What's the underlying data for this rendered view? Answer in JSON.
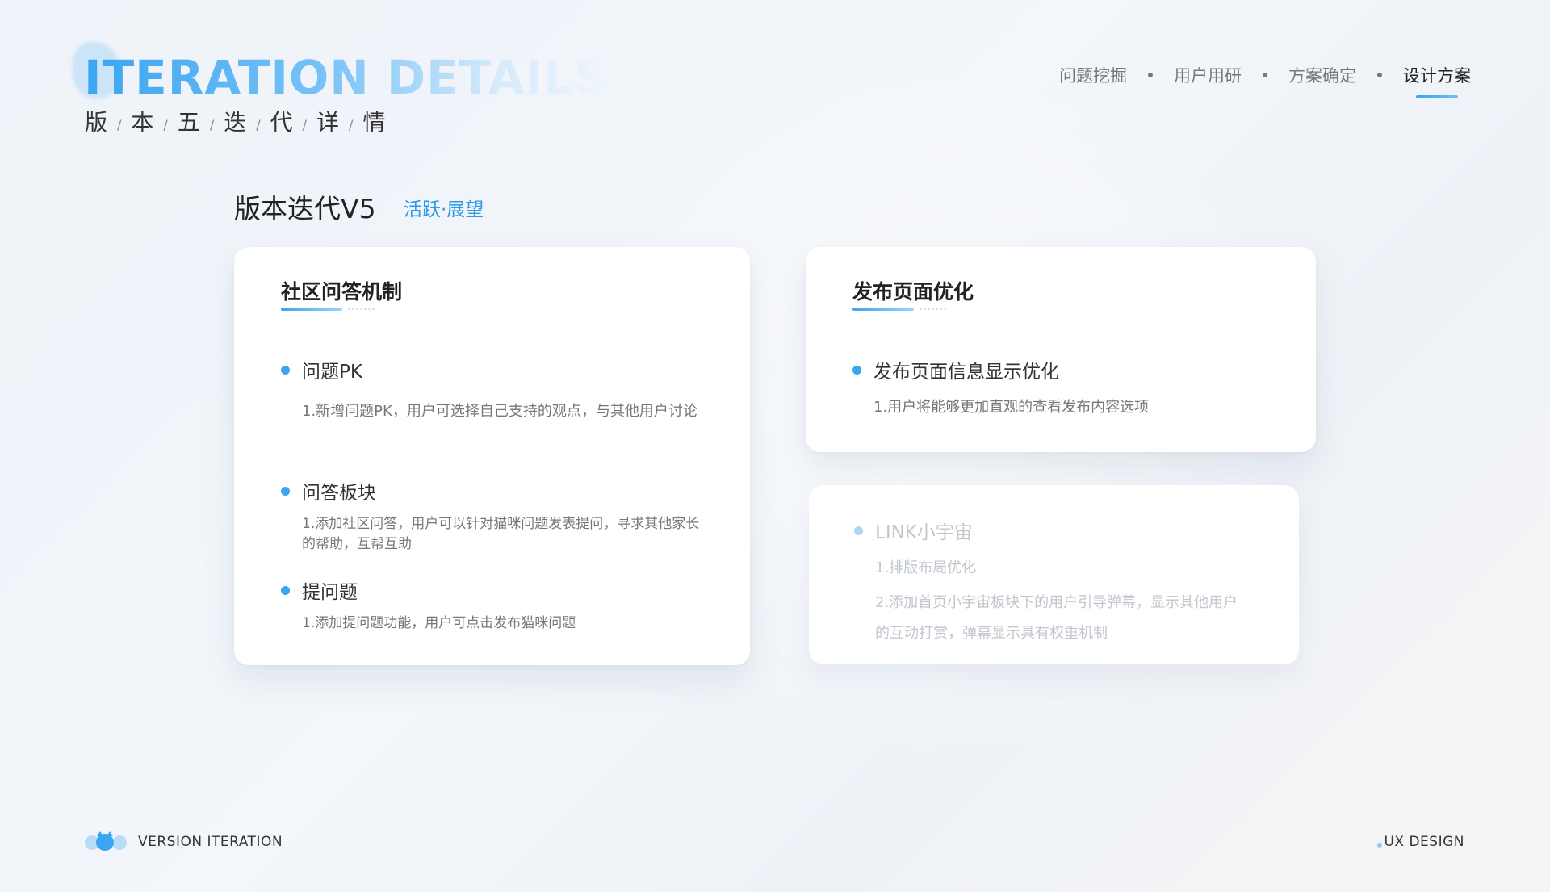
{
  "header": {
    "hero_title": "ITERATION DETAILS",
    "subtitle_chars": [
      "版",
      "本",
      "五",
      "迭",
      "代",
      "详",
      "情"
    ],
    "subtitle_separator": "/"
  },
  "nav": {
    "items": [
      {
        "label": "问题挖掘",
        "active": false
      },
      {
        "label": "用户用研",
        "active": false
      },
      {
        "label": "方案确定",
        "active": false
      },
      {
        "label": "设计方案",
        "active": true
      }
    ]
  },
  "section": {
    "title": "版本迭代V5",
    "tag": "活跃·展望"
  },
  "cards": [
    {
      "title": "社区问答机制",
      "items": [
        {
          "heading": "问题PK",
          "desc": "1.新增问题PK，用户可选择自己支持的观点，与其他用户讨论"
        },
        {
          "heading": "问答板块",
          "desc": "1.添加社区问答，用户可以针对猫咪问题发表提问，寻求其他家长的帮助，互帮互助"
        },
        {
          "heading": "提问题",
          "desc": "1.添加提问题功能，用户可点击发布猫咪问题"
        }
      ]
    },
    {
      "title": "发布页面优化",
      "items": [
        {
          "heading": "发布页面信息显示优化",
          "desc": "1.用户将能够更加直观的查看发布内容选项"
        }
      ]
    },
    {
      "title": "",
      "items": [
        {
          "heading": "LINK小宇宙",
          "desc": "1.排版布局优化",
          "desc2": "2.添加首页小宇宙板块下的用户引导弹幕，显示其他用户的互动打赏，弹幕显示具有权重机制"
        }
      ]
    }
  ],
  "footer": {
    "left_label": "VERSION ITERATION",
    "right_label": "UX DESIGN"
  },
  "colors": {
    "accent": "#3aa5f0",
    "tag": "#2a9ae8",
    "muted_text": "#777777",
    "faded_text": "#c2c7ce"
  }
}
